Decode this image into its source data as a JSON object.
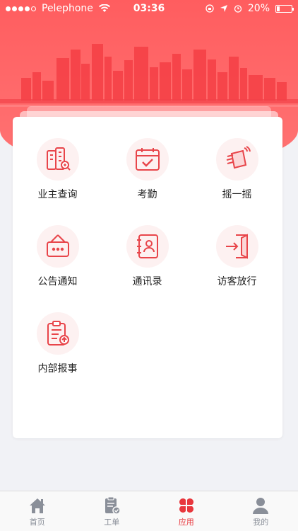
{
  "status_bar": {
    "carrier": "Pelephone",
    "time": "03:36",
    "battery": "20%",
    "battery_level": 0.2,
    "signal_bars": 4
  },
  "apps": [
    {
      "label": "业主查询",
      "icon": "building-search-icon"
    },
    {
      "label": "考勤",
      "icon": "calendar-check-icon"
    },
    {
      "label": "摇一摇",
      "icon": "shake-phone-icon"
    },
    {
      "label": "公告通知",
      "icon": "notice-board-icon"
    },
    {
      "label": "通讯录",
      "icon": "contacts-book-icon"
    },
    {
      "label": "访客放行",
      "icon": "door-enter-icon"
    },
    {
      "label": "内部报事",
      "icon": "clipboard-report-icon"
    }
  ],
  "tabbar": {
    "items": [
      {
        "label": "首页",
        "icon": "home-icon"
      },
      {
        "label": "工单",
        "icon": "work-order-icon"
      },
      {
        "label": "应用",
        "icon": "apps-clover-icon"
      },
      {
        "label": "我的",
        "icon": "profile-icon"
      }
    ],
    "active_index": 2
  },
  "colors": {
    "brand": "#ff5d5f",
    "icon": "#e8454a",
    "tab_active": "#e8373d",
    "tab_inactive": "#8a8f99"
  }
}
